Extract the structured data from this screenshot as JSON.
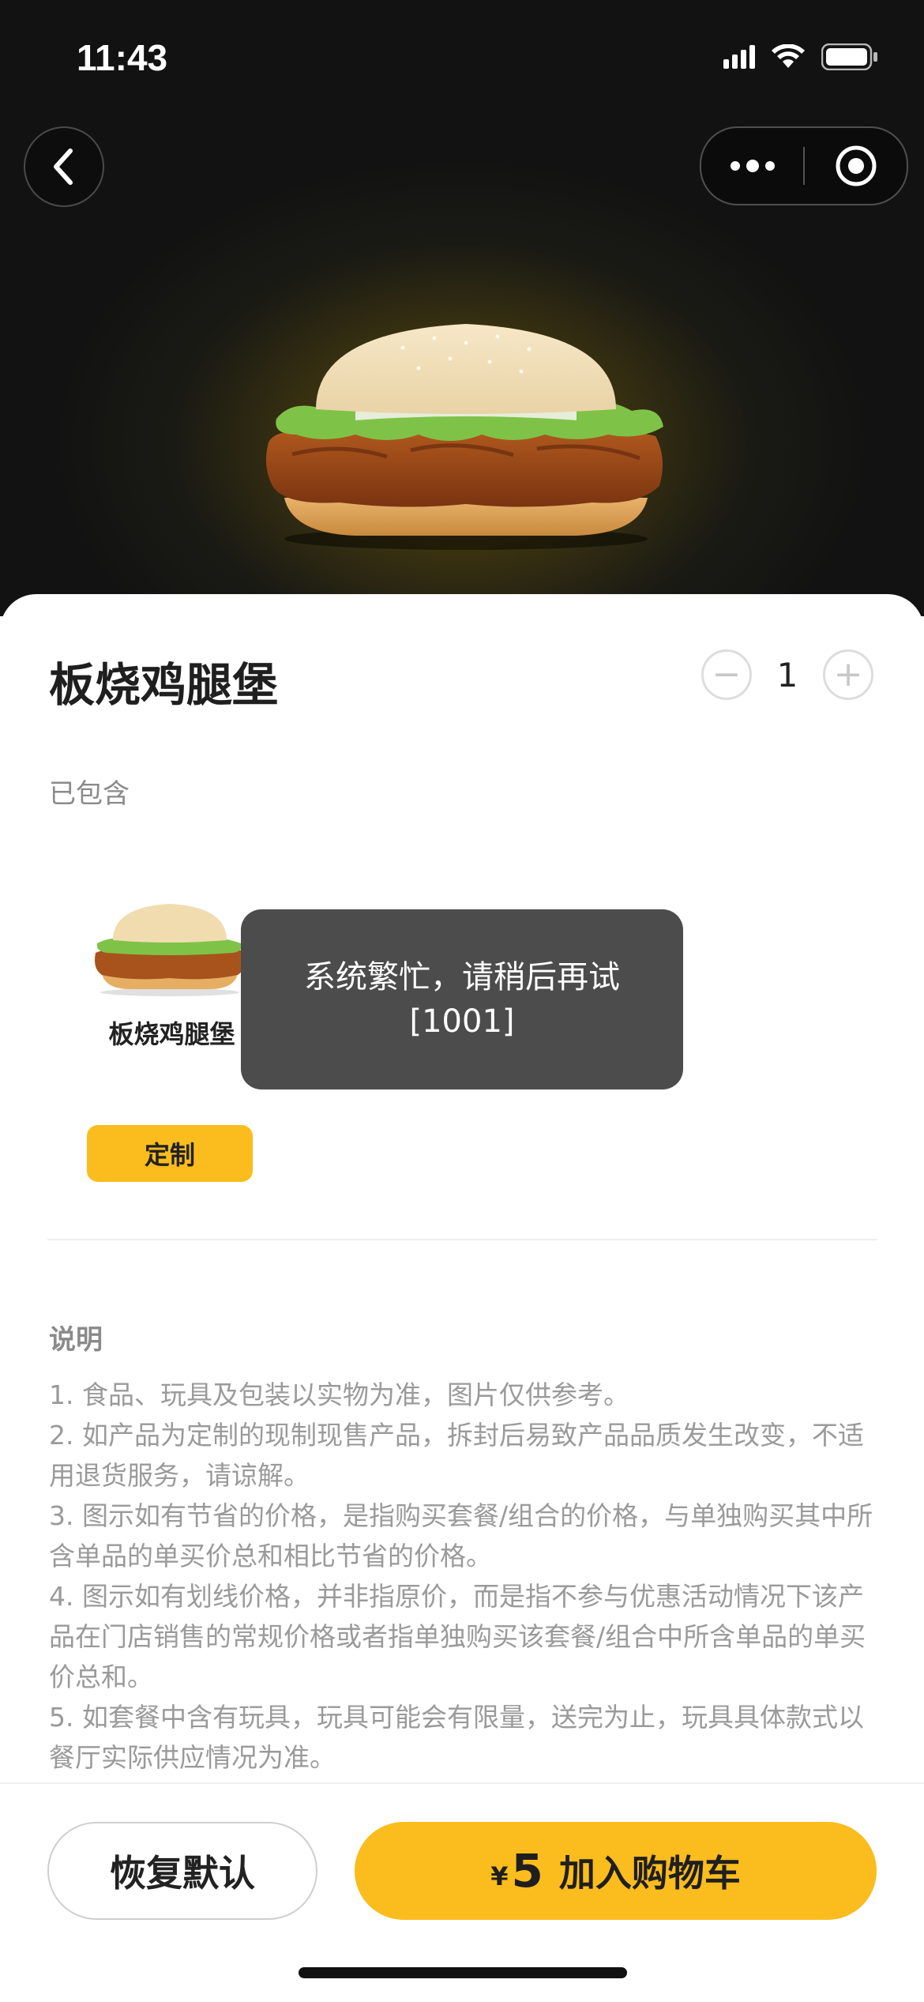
{
  "status_bar": {
    "time": "11:43"
  },
  "nav": {
    "back_icon": "chevron-left-icon",
    "more_icon": "more-dots-icon",
    "close_icon": "target-circle-icon"
  },
  "product": {
    "title": "板烧鸡腿堡",
    "quantity": "1",
    "minus_symbol": "−",
    "plus_symbol": "+"
  },
  "included": {
    "label": "已包含",
    "items": [
      {
        "name": "板烧鸡腿堡"
      }
    ],
    "customize_label": "定制"
  },
  "description": {
    "heading": "说明",
    "lines": [
      "1. 食品、玩具及包装以实物为准，图片仅供参考。",
      "2. 如产品为定制的现制现售产品，拆封后易致产品品质发生改变，不适用退货服务，请谅解。",
      "3. 图示如有节省的价格，是指购买套餐/组合的价格，与单独购买其中所含单品的单买价总和相比节省的价格。",
      "4. 图示如有划线价格，并非指原价，而是指不参与优惠活动情况下该产品在门店销售的常规价格或者指单独购买该套餐/组合中所含单品的单买价总和。",
      "5. 如套餐中含有玩具，玩具可能会有限量，送完为止，玩具具体款式以餐厅实际供应情况为准。"
    ]
  },
  "toast": {
    "line1": "系统繁忙，请稍后再试",
    "line2": "[1001]"
  },
  "bottom_bar": {
    "reset_label": "恢复默认",
    "currency": "¥",
    "price": "5",
    "add_to_cart_label": "加入购物车"
  },
  "colors": {
    "accent": "#fbbc1d",
    "toast_bg": "#4c4c4c",
    "hero_bg": "#121212"
  }
}
